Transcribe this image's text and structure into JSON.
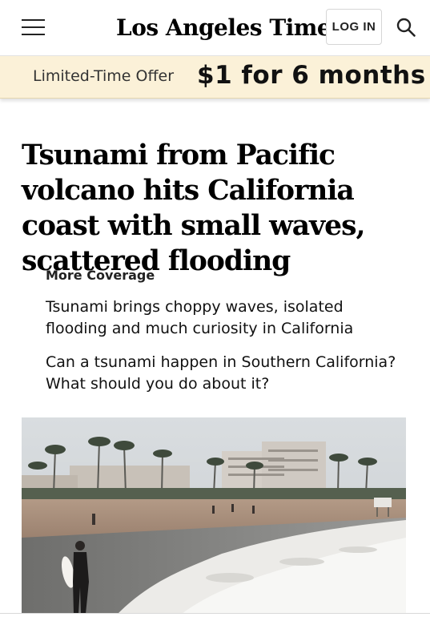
{
  "header": {
    "menu_icon": "hamburger-menu-icon",
    "logo_text": "Los Angeles Times",
    "login_label": "LOG IN",
    "search_icon": "search-icon"
  },
  "offer": {
    "label": "Limited-Time Offer",
    "price": "$1 for 6 months",
    "background_color": "#fbf1d8"
  },
  "article": {
    "headline": "Tsunami from Pacific volcano hits California coast with small waves, scattered flooding"
  },
  "more_coverage": {
    "heading": "More Coverage",
    "links": [
      "Tsunami brings choppy waves, isolated flooding and much curiosity in California",
      "Can a tsunami happen in Southern California? What should you do about it?"
    ]
  }
}
